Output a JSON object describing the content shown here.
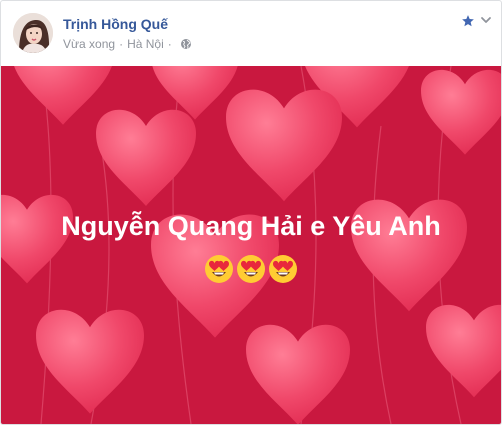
{
  "post": {
    "author_name": "Trịnh Hồng Quế",
    "time_text": "Vừa xong",
    "separator": "·",
    "location": "Hà Nội",
    "privacy_icon": "globe-icon",
    "message": "Nguyễn Quang Hải e Yêu Anh",
    "emojis": [
      "heart-eyes-emoji",
      "heart-eyes-emoji",
      "heart-eyes-emoji"
    ],
    "background_theme": "red-hearts",
    "colors": {
      "background": "#c9183f",
      "heart": "#f0486a",
      "name": "#365899",
      "meta": "#90949c",
      "star": "#4267b2"
    }
  }
}
